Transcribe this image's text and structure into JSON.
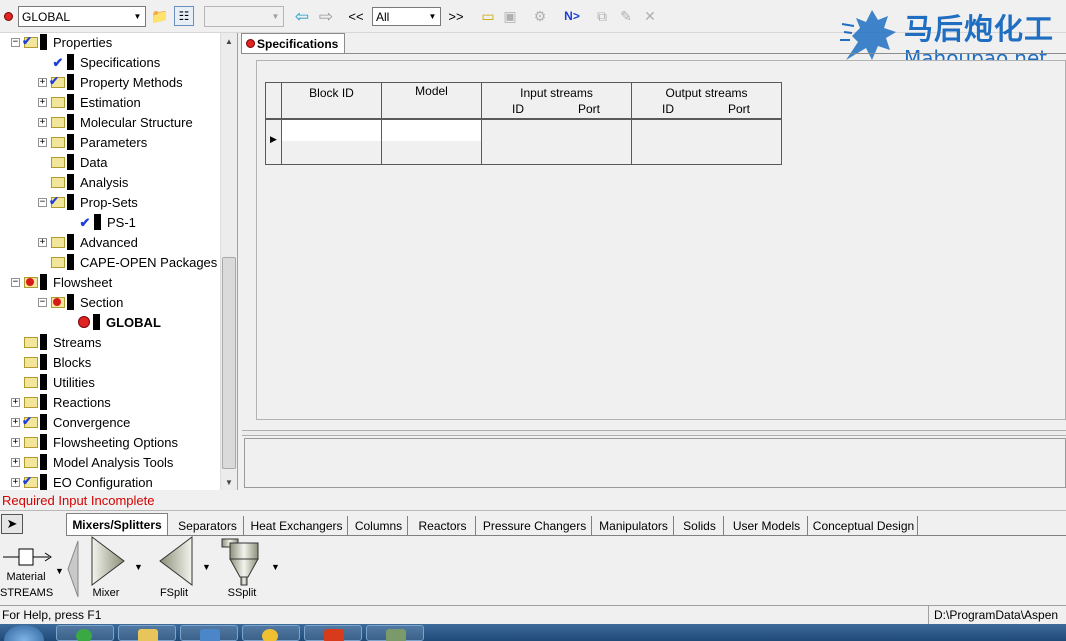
{
  "toolbar": {
    "context_combo": {
      "value": "GLOBAL"
    },
    "empty_combo": {
      "value": ""
    },
    "nav_prev_label": "<<",
    "nav_next_label": ">>",
    "filter_combo": {
      "value": "All"
    },
    "next_label": "N>"
  },
  "watermark": {
    "chinese": "马后炮化工",
    "domain": "Mahoupao.net"
  },
  "tree": {
    "items": [
      {
        "label": "Properties",
        "level": 0,
        "expander": "-",
        "icon": "folder-check"
      },
      {
        "label": "Specifications",
        "level": 1,
        "expander": "",
        "icon": "spec-check"
      },
      {
        "label": "Property Methods",
        "level": 1,
        "expander": "+",
        "icon": "folder-check"
      },
      {
        "label": "Estimation",
        "level": 1,
        "expander": "+",
        "icon": "folder"
      },
      {
        "label": "Molecular Structure",
        "level": 1,
        "expander": "+",
        "icon": "folder"
      },
      {
        "label": "Parameters",
        "level": 1,
        "expander": "+",
        "icon": "folder"
      },
      {
        "label": "Data",
        "level": 1,
        "expander": "",
        "icon": "folder"
      },
      {
        "label": "Analysis",
        "level": 1,
        "expander": "",
        "icon": "folder"
      },
      {
        "label": "Prop-Sets",
        "level": 1,
        "expander": "-",
        "icon": "folder-check"
      },
      {
        "label": "PS-1",
        "level": 2,
        "expander": "",
        "icon": "spec-check"
      },
      {
        "label": "Advanced",
        "level": 1,
        "expander": "+",
        "icon": "folder"
      },
      {
        "label": "CAPE-OPEN Packages",
        "level": 1,
        "expander": "",
        "icon": "folder"
      },
      {
        "label": "Flowsheet",
        "level": 0,
        "expander": "-",
        "icon": "folder-red"
      },
      {
        "label": "Section",
        "level": 1,
        "expander": "-",
        "icon": "folder-red"
      },
      {
        "label": "GLOBAL",
        "level": 2,
        "expander": "",
        "icon": "red-dot",
        "bold": true
      },
      {
        "label": "Streams",
        "level": 0,
        "expander": "",
        "icon": "folder"
      },
      {
        "label": "Blocks",
        "level": 0,
        "expander": "",
        "icon": "folder"
      },
      {
        "label": "Utilities",
        "level": 0,
        "expander": "",
        "icon": "folder"
      },
      {
        "label": "Reactions",
        "level": 0,
        "expander": "+",
        "icon": "folder"
      },
      {
        "label": "Convergence",
        "level": 0,
        "expander": "+",
        "icon": "folder-check"
      },
      {
        "label": "Flowsheeting Options",
        "level": 0,
        "expander": "+",
        "icon": "folder"
      },
      {
        "label": "Model Analysis Tools",
        "level": 0,
        "expander": "+",
        "icon": "folder"
      },
      {
        "label": "EO Configuration",
        "level": 0,
        "expander": "+",
        "icon": "folder-check"
      }
    ]
  },
  "form": {
    "tab_label": "Specifications",
    "grid": {
      "col_block_id": "Block ID",
      "col_model": "Model",
      "col_input": "Input streams",
      "col_output": "Output streams",
      "sub_id": "ID",
      "sub_port": "Port"
    }
  },
  "status": {
    "required": "Required Input Incomplete",
    "help": "For Help, press F1",
    "path": "D:\\ProgramData\\Aspen"
  },
  "library": {
    "tabs": [
      "Mixers/Splitters",
      "Separators",
      "Heat Exchangers",
      "Columns",
      "Reactors",
      "Pressure Changers",
      "Manipulators",
      "Solids",
      "User Models",
      "Conceptual Design"
    ],
    "active_tab": 0,
    "stream_label_1": "Material",
    "stream_label_2": "STREAMS",
    "models": [
      "Mixer",
      "FSplit",
      "SSplit"
    ]
  }
}
